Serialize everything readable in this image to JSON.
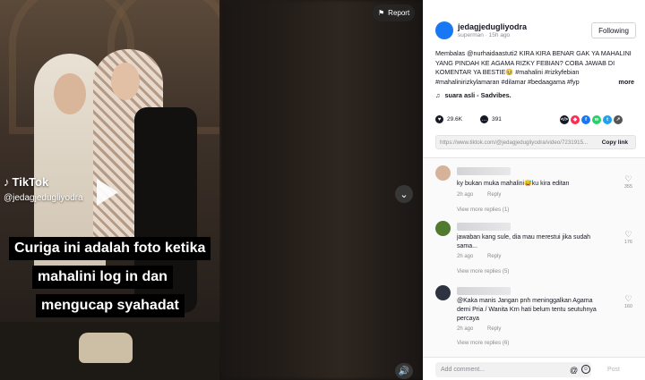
{
  "video": {
    "watermark_brand": "TikTok",
    "watermark_handle": "@jedagjedugliyodra",
    "caption_lines": [
      "Curiga ini adalah foto ketika",
      "mahalini log in dan",
      "mengucap syahadat"
    ],
    "report_label": "Report",
    "nav_icon": "chevron-down-icon",
    "sound_icon": "speaker-icon"
  },
  "panel": {
    "author": {
      "username": "jedagjedugliyodra",
      "subtitle": "superman · 15h ago",
      "avatar_color": "#1877f2"
    },
    "follow_label": "Following",
    "description": "Membalas @nurhaidaastuti2 KIRA KIRA BENAR GAK YA MAHALINI YANG PINDAH KE AGAMA RIZKY FEBIAN? COBA JAWAB DI KOMENTAR YA BESTIE🥹 #mahalini #rizkyfebian #mahalinirizkylamaran #dilamar #bedaagama #fyp",
    "more_label": "more",
    "sound_label": "suara asli - Sadvibes.",
    "likes": "29.6K",
    "comments_count": "391",
    "share_targets": [
      {
        "label": "</>",
        "color": "#161823"
      },
      {
        "label": "◆",
        "color": "#fe2c55"
      },
      {
        "label": "f",
        "color": "#1877f2"
      },
      {
        "label": "w",
        "color": "#25d366"
      },
      {
        "label": "t",
        "color": "#1da1f2"
      },
      {
        "label": "↗",
        "color": "#555"
      }
    ],
    "link": "https://www.tiktok.com/@jedagjedugliyodra/video/7231915...",
    "copy_link_label": "Copy link"
  },
  "comments": [
    {
      "text": "ky bukan muka mahalini😅ku kira editan",
      "time": "2h ago",
      "reply": "Reply",
      "view_replies": "View more replies (1)",
      "likes": "355",
      "avatar_color": "#d6b29a"
    },
    {
      "text": "jawaban kang sule, dia mau merestui jika sudah sama...",
      "time": "2h ago",
      "reply": "Reply",
      "view_replies": "View more replies (5)",
      "likes": "176",
      "avatar_color": "#4f7a2f"
    },
    {
      "text": "@Kaka manis Jangan pnh meninggalkan Agama demi Pria / Wanita Krn hati belum tentu seutuhnya percaya",
      "time": "2h ago",
      "reply": "Reply",
      "view_replies": "View more replies (6)",
      "likes": "160",
      "avatar_color": "#2f3340"
    }
  ],
  "add_comment": {
    "placeholder": "Add comment...",
    "at_symbol": "@",
    "emoji_symbol": "☺",
    "post_label": "Post"
  }
}
